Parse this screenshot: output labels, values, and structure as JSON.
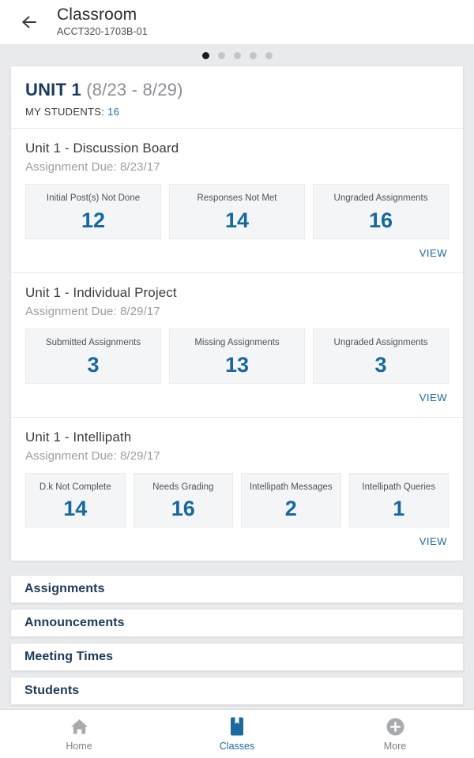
{
  "colors": {
    "accent_blue": "#1a6a9e",
    "navy": "#183a5e",
    "muted": "#9a9ea2",
    "tab_inactive": "#7d8084"
  },
  "header": {
    "back_icon": "arrow-left-icon",
    "title": "Classroom",
    "subtitle": "ACCT320-1703B-01"
  },
  "pager": {
    "total": 5,
    "active_index": 0
  },
  "unit": {
    "title": "UNIT 1",
    "date_range": "(8/23 - 8/29)",
    "students_label": "MY STUDENTS:",
    "students_count": "16",
    "assignments": [
      {
        "title": "Unit 1 - Discussion Board",
        "due": "Assignment Due: 8/23/17",
        "view_label": "VIEW",
        "stats": [
          {
            "label": "Initial Post(s) Not Done",
            "value": "12"
          },
          {
            "label": "Responses Not Met",
            "value": "14"
          },
          {
            "label": "Ungraded Assignments",
            "value": "16"
          }
        ]
      },
      {
        "title": "Unit 1 - Individual Project",
        "due": "Assignment Due: 8/29/17",
        "view_label": "VIEW",
        "stats": [
          {
            "label": "Submitted Assignments",
            "value": "3"
          },
          {
            "label": "Missing Assignments",
            "value": "13"
          },
          {
            "label": "Ungraded Assignments",
            "value": "3"
          }
        ]
      },
      {
        "title": "Unit 1 - Intellipath",
        "due": "Assignment Due: 8/29/17",
        "view_label": "VIEW",
        "stats": [
          {
            "label": "D.k Not Complete",
            "value": "14"
          },
          {
            "label": "Needs Grading",
            "value": "16"
          },
          {
            "label": "Intellipath Messages",
            "value": "2"
          },
          {
            "label": "Intellipath Queries",
            "value": "1"
          }
        ]
      }
    ]
  },
  "navlist": [
    {
      "label": "Assignments"
    },
    {
      "label": "Announcements"
    },
    {
      "label": "Meeting Times"
    },
    {
      "label": "Students"
    }
  ],
  "tabbar": [
    {
      "label": "Home",
      "icon": "home-icon",
      "active": false
    },
    {
      "label": "Classes",
      "icon": "book-bookmark-icon",
      "active": true
    },
    {
      "label": "More",
      "icon": "plus-circle-icon",
      "active": false
    }
  ]
}
